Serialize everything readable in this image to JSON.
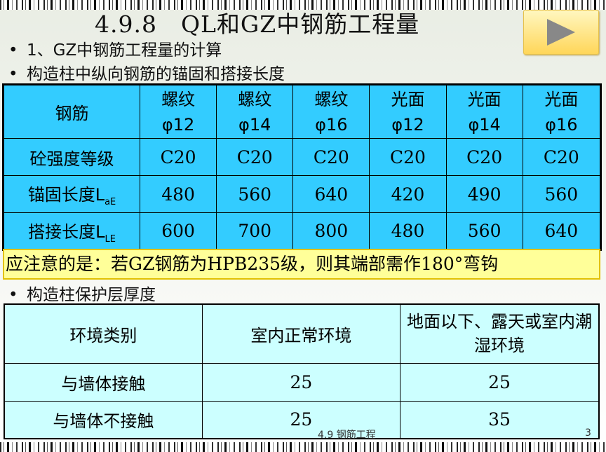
{
  "slide": {
    "title": "4.9.8　QL和GZ中钢筋工程量",
    "bullets": [
      "1、GZ中钢筋工程量的计算",
      "构造柱中纵向钢筋的锚固和搭接长度",
      "构造柱保护层厚度"
    ],
    "bullet_marker": "•",
    "footer": "4.9 钢筋工程",
    "page_number": "3"
  },
  "rebar_table": {
    "row_header": "钢筋",
    "columns": [
      {
        "type": "螺纹",
        "dia": "φ12"
      },
      {
        "type": "螺纹",
        "dia": "φ14"
      },
      {
        "type": "螺纹",
        "dia": "φ16"
      },
      {
        "type": "光面",
        "dia": "φ12"
      },
      {
        "type": "光面",
        "dia": "φ14"
      },
      {
        "type": "光面",
        "dia": "φ16"
      }
    ],
    "rows": [
      {
        "label": "砼强度等级",
        "sub": "",
        "values": [
          "C20",
          "C20",
          "C20",
          "C20",
          "C20",
          "C20"
        ]
      },
      {
        "label": "锚固长度L",
        "sub": "aE",
        "values": [
          "480",
          "560",
          "640",
          "420",
          "490",
          "560"
        ]
      },
      {
        "label": "搭接长度L",
        "sub": "LE",
        "values": [
          "600",
          "700",
          "800",
          "480",
          "560",
          "640"
        ]
      }
    ]
  },
  "note": "应注意的是：若GZ钢筋为HPB235级，则其端部需作180°弯钩",
  "cover_table": {
    "headers": [
      "环境类别",
      "室内正常环境",
      "地面以下、露天或室内潮湿环境"
    ],
    "rows": [
      [
        "与墙体接触",
        "25",
        "25"
      ],
      [
        "与墙体不接触",
        "25",
        "35"
      ]
    ]
  }
}
